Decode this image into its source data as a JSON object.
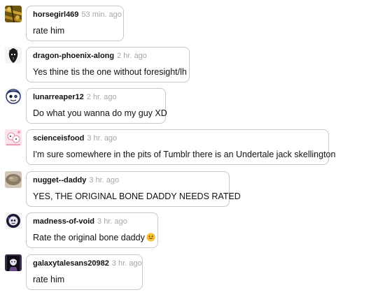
{
  "comments": [
    {
      "user": "horsegirl469",
      "time": "53 min. ago",
      "text": "rate him",
      "avatar": "gold-texture-avatar"
    },
    {
      "user": "dragon-phoenix-along",
      "time": "2 hr. ago",
      "text": "Yes thine tis the one without foresight/lh",
      "avatar": "black-dragon-head-avatar"
    },
    {
      "user": "lunarreaper12",
      "time": "2 hr. ago",
      "text": "Do what you wanna do my guy XD",
      "avatar": "skull-face-avatar"
    },
    {
      "user": "scienceisfood",
      "time": "3 hr. ago",
      "text": "I'm sure somewhere in the pits of Tumblr there is an Undertale jack skellington",
      "avatar": "pink-cartoon-avatar"
    },
    {
      "user": "nugget--daddy",
      "time": "3 hr. ago",
      "text": "YES, THE ORIGINAL BONE DADDY NEEDS RATED",
      "avatar": "brown-blur-avatar"
    },
    {
      "user": "madness-of-void",
      "time": "3 hr. ago",
      "text": "Rate the original bone daddy",
      "emoji": "grinning-sweat-emoji",
      "avatar": "dark-character-avatar"
    },
    {
      "user": "galaxytalesans20982",
      "time": "3 hr. ago",
      "text": "rate him",
      "avatar": "black-character-avatar"
    }
  ]
}
